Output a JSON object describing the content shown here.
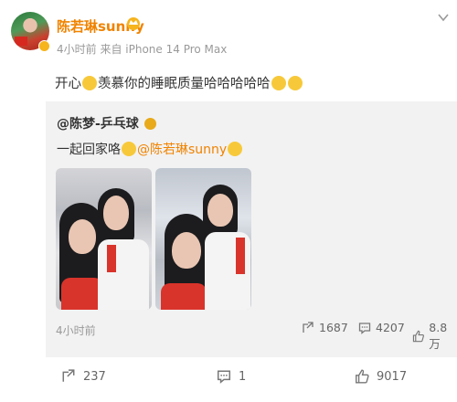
{
  "post": {
    "username": "陈若琳sunny",
    "time": "4小时前",
    "source": "来自 iPhone 14 Pro Max",
    "text_start": "开心",
    "text_body": "羡慕你的睡眠质量哈哈哈哈哈"
  },
  "repost": {
    "author": "@陈梦-乒乓球",
    "text": "一起回家咯",
    "mention": "@陈若琳sunny",
    "time": "4小时前",
    "reposts": "1687",
    "comments": "4207",
    "likes": "8.8万"
  },
  "footer": {
    "reposts": "237",
    "comments": "1",
    "likes": "9017"
  },
  "colors": {
    "accent": "#f08300",
    "repost_bg": "#f2f2f2"
  }
}
